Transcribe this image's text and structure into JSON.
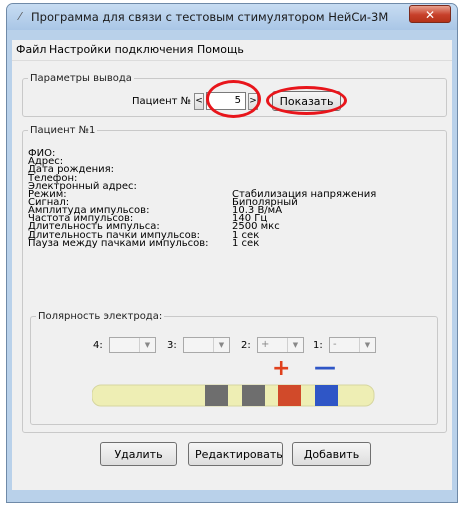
{
  "window": {
    "title": "Программа для связи с тестовым стимулятором НейСи-3М",
    "close_glyph": "✕",
    "app_icon": "wand-icon"
  },
  "menu": {
    "items": [
      "Файл",
      "Настройки подключения",
      "Помощь"
    ]
  },
  "output_params": {
    "title": "Параметры вывода",
    "patient_label": "Пациент №",
    "patient_number": "5",
    "dec_glyph": "<",
    "inc_glyph": ">",
    "show_button": "Показать"
  },
  "patient": {
    "title": "Пациент №1",
    "rows": [
      {
        "label": "ФИО:",
        "value": ""
      },
      {
        "label": "Адрес:",
        "value": ""
      },
      {
        "label": "Дата рождения:",
        "value": ""
      },
      {
        "label": "Телефон:",
        "value": ""
      },
      {
        "label": "Электронный адрес:",
        "value": ""
      },
      {
        "label": "Режим:",
        "value": "Стабилизация напряжения"
      },
      {
        "label": "Сигнал:",
        "value": "Биполярный"
      },
      {
        "label": "Амплитуда импульсов:",
        "value": "10.3 В/мА"
      },
      {
        "label": "Частота импульсов:",
        "value": "140 Гц"
      },
      {
        "label": "Длительность импульса:",
        "value": "2500 мкс"
      },
      {
        "label": "Длительность пачки импульсов:",
        "value": "1 сек"
      },
      {
        "label": "Пауза между пачками импульсов:",
        "value": "1 сек"
      }
    ]
  },
  "polarity": {
    "title": "Полярность электрода:",
    "contacts": [
      {
        "label": "4:",
        "value": ""
      },
      {
        "label": "3:",
        "value": ""
      },
      {
        "label": "2:",
        "value": "+"
      },
      {
        "label": "1:",
        "value": "-"
      }
    ],
    "plus_glyph": "+",
    "minus_glyph": "—",
    "colors": {
      "lead": "#eeeeb4",
      "neutral": "#6e6e6e",
      "anode": "#d14a2a",
      "cathode": "#2f56c6"
    }
  },
  "buttons": {
    "delete": "Удалить",
    "edit": "Редактировать",
    "add": "Добавить"
  }
}
